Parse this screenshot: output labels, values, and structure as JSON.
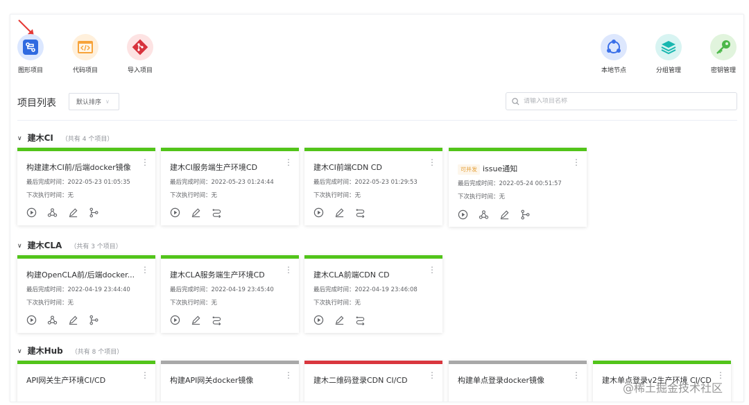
{
  "toolbar": {
    "graphic_project": "图形项目",
    "code_project": "代码项目",
    "import_project": "导入项目",
    "local_node": "本地节点",
    "group_manage": "分组管理",
    "key_manage": "密钥管理"
  },
  "list": {
    "title": "项目列表",
    "sort_label": "默认排序",
    "search_placeholder": "请输入项目名称"
  },
  "groups": [
    {
      "name": "建木CI",
      "count": "（共有 4 个项目）",
      "cards": [
        {
          "title": "构建建木CI前/后端docker镜像",
          "last_done": "最后完成时间：2022-05-23 01:05:35",
          "next_run": "下次执行时间：无"
        },
        {
          "title": "建木CI服务端生产环境CD",
          "last_done": "最后完成时间：2022-05-23 01:24:44",
          "next_run": "下次执行时间：无"
        },
        {
          "title": "建木CI前端CDN CD",
          "last_done": "最后完成时间：2022-05-23 01:29:53",
          "next_run": "下次执行时间：无"
        },
        {
          "tag": "可并发",
          "title": "issue通知",
          "last_done": "最后完成时间：2022-05-24 00:51:57",
          "next_run": "下次执行时间：无"
        }
      ]
    },
    {
      "name": "建木CLA",
      "count": "（共有 3 个项目）",
      "cards": [
        {
          "title": "构建OpenCLA前/后端docker...",
          "last_done": "最后完成时间：2022-04-19 23:44:40",
          "next_run": "下次执行时间：无"
        },
        {
          "title": "建木CLA服务端生产环境CD",
          "last_done": "最后完成时间：2022-04-19 23:45:40",
          "next_run": "下次执行时间：无"
        },
        {
          "title": "建木CLA前端CDN CD",
          "last_done": "最后完成时间：2022-04-19 23:46:08",
          "next_run": "下次执行时间：无"
        }
      ]
    },
    {
      "name": "建木Hub",
      "count": "（共有 8 个项目）",
      "cards": [
        {
          "title": "API网关生产环境CI/CD"
        },
        {
          "title": "构建API网关docker镜像"
        },
        {
          "title": "建木二维码登录CDN CI/CD"
        },
        {
          "title": "构建单点登录docker镜像"
        },
        {
          "title": "建木单点登录v2生产环境 CI/CD"
        }
      ]
    }
  ],
  "colors": {
    "success": "#52c41a",
    "neutral": "#a8a8a8",
    "failed": "#d9363e",
    "graphic_icon": "#2f6ae0",
    "code_icon": "#f7a33a",
    "import_icon": "#d7323c",
    "node_icon": "#3a6fe8",
    "group_icon": "#19b7b0",
    "key_icon": "#4cb84a"
  },
  "watermark": "@稀土掘金技术社区"
}
